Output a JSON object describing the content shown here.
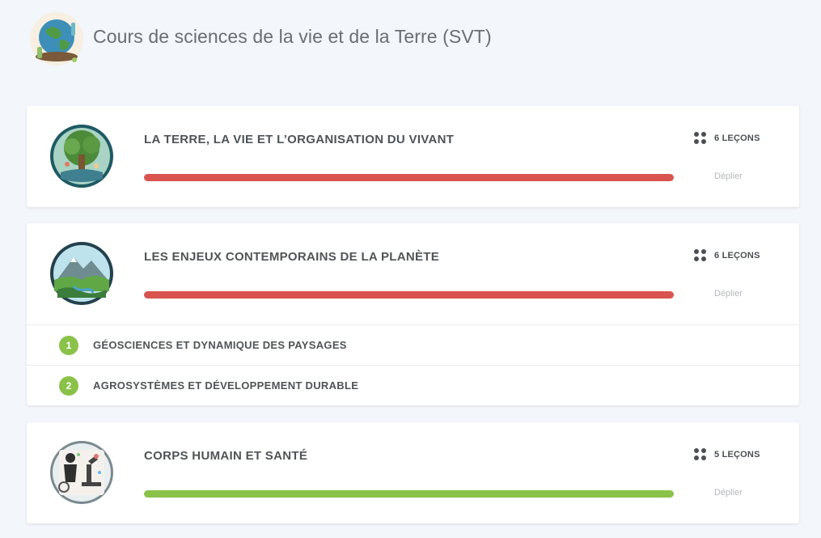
{
  "header": {
    "title": "Cours de sciences de la vie et de la Terre (SVT)",
    "logo_icon": "earth-globe-science-icon"
  },
  "chapters": [
    {
      "title": "LA TERRE, LA VIE ET L’ORGANISATION DU VIVANT",
      "lessons": "6 LEÇONS",
      "expand_label": "Déplier",
      "progress": 1.0,
      "progress_color": "#d9534f",
      "thumb_icon": "tree-of-life-icon",
      "lessons_icon": "grid-dots-icon",
      "sub_items": []
    },
    {
      "title": "LES ENJEUX CONTEMPORAINS DE LA PLANÈTE",
      "lessons": "6 LEÇONS",
      "expand_label": "Déplier",
      "progress": 1.0,
      "progress_color": "#d9534f",
      "thumb_icon": "mountain-landscape-icon",
      "lessons_icon": "grid-dots-icon",
      "sub_items": [
        {
          "number": "1",
          "title": "GÉOSCIENCES ET DYNAMIQUE DES PAYSAGES"
        },
        {
          "number": "2",
          "title": "AGROSYSTÈMES ET DÉVELOPPEMENT DURABLE"
        }
      ]
    },
    {
      "title": "CORPS HUMAIN ET SANTÉ",
      "lessons": "5 LEÇONS",
      "expand_label": "Déplier",
      "progress": 1.0,
      "progress_color": "#8ac249",
      "thumb_icon": "microscope-health-icon",
      "lessons_icon": "grid-dots-icon",
      "sub_items": []
    }
  ]
}
